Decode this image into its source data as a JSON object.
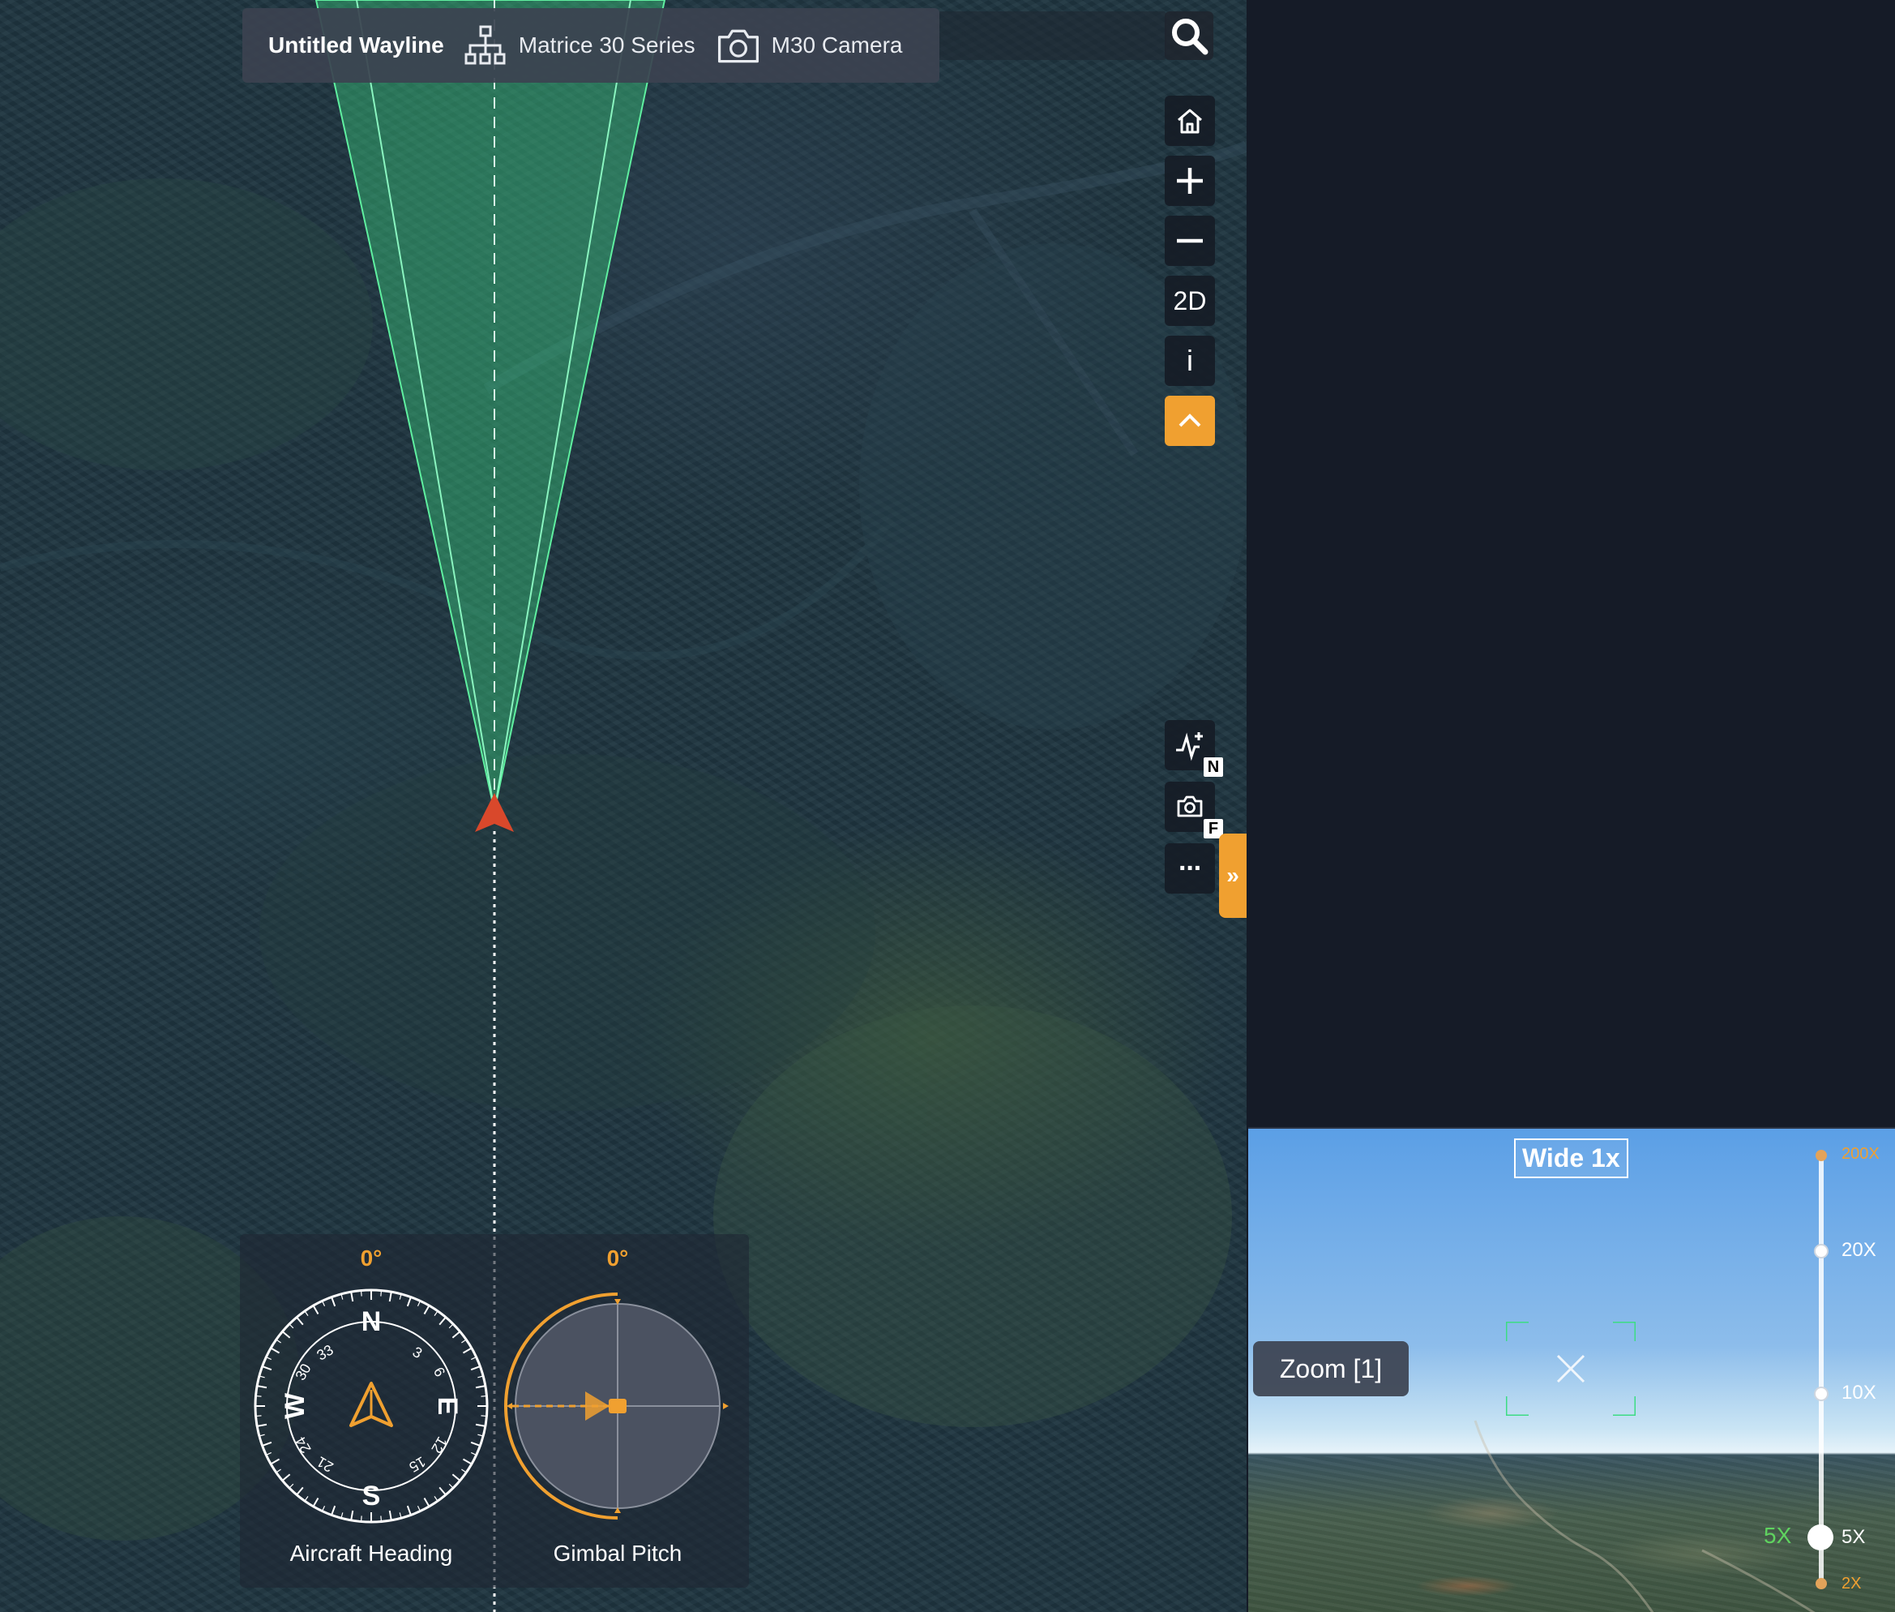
{
  "header": {
    "wayline_title": "Untitled Wayline",
    "aircraft": "Matrice 30 Series",
    "camera": "M30 Camera"
  },
  "toolbar": {
    "view_mode": "2D",
    "info": "i",
    "icons": [
      "home-icon",
      "zoom-in-icon",
      "zoom-out-icon",
      "view-2d",
      "info-icon",
      "collapse-up-icon",
      "add-waypoint-icon",
      "camera-action-icon",
      "more-icon"
    ],
    "waypoint_badge": "N",
    "camera_badge": "F",
    "more": "···",
    "panel_toggle": "»"
  },
  "dials": {
    "heading": {
      "caption": "Aircraft Heading",
      "value": "0°",
      "cardinals": [
        "N",
        "E",
        "S",
        "W"
      ],
      "ticks": [
        "3",
        "6",
        "12",
        "15",
        "21",
        "24",
        "30",
        "33"
      ]
    },
    "gimbal": {
      "caption": "Gimbal Pitch",
      "value": "0°"
    }
  },
  "preview": {
    "lens": "Wide 1x",
    "zoom_badge": "Zoom [1]",
    "zoom_levels": [
      "200X",
      "20X",
      "10X",
      "5X",
      "2X"
    ],
    "current_zoom": "5X"
  },
  "colors": {
    "accent": "#f0a030",
    "fov": "#3ddc84",
    "aircraft_marker": "#d9482b",
    "panel_bg": "#151b27"
  }
}
